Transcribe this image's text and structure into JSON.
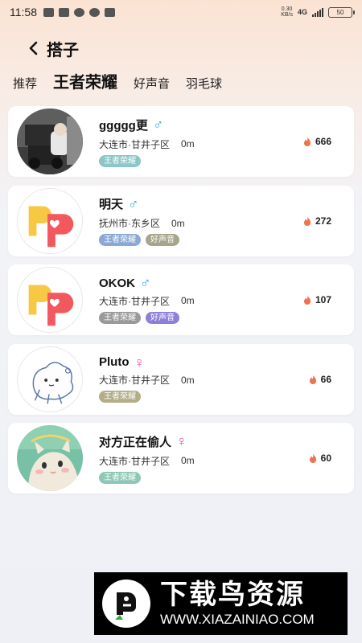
{
  "status_bar": {
    "time": "11:58",
    "netspeed_top": "0.30",
    "netspeed_bottom": "KB/s",
    "network": "4G",
    "battery": "50"
  },
  "header": {
    "title": "搭子"
  },
  "tabs": [
    {
      "label": "推荐",
      "active": false
    },
    {
      "label": "王者荣耀",
      "active": true
    },
    {
      "label": "好声音",
      "active": false
    },
    {
      "label": "羽毛球",
      "active": false
    }
  ],
  "users": [
    {
      "name": "ggggg更",
      "gender": "male",
      "gender_symbol": "♂",
      "city": "大连市·甘井子区",
      "distance": "0m",
      "tags": [
        "王者荣耀"
      ],
      "heat": "666"
    },
    {
      "name": "明天",
      "gender": "male",
      "gender_symbol": "♂",
      "city": "抚州市·东乡区",
      "distance": "0m",
      "tags": [
        "王者荣耀",
        "好声音"
      ],
      "heat": "272"
    },
    {
      "name": "OKOK",
      "gender": "male",
      "gender_symbol": "♂",
      "city": "大连市·甘井子区",
      "distance": "0m",
      "tags": [
        "王者荣耀",
        "好声音"
      ],
      "heat": "107"
    },
    {
      "name": "Pluto",
      "gender": "female",
      "gender_symbol": "♀",
      "city": "大连市·甘井子区",
      "distance": "0m",
      "tags": [
        "王者荣耀"
      ],
      "heat": "66"
    },
    {
      "name": "对方正在偷人",
      "gender": "female",
      "gender_symbol": "♀",
      "city": "大连市·甘井子区",
      "distance": "0m",
      "tags": [
        "王者荣耀"
      ],
      "heat": "60"
    }
  ],
  "tag_colors": [
    "#8cc6c6",
    "#8aa8d6",
    "#9a9a9a",
    "#b3ae88",
    "#8ec7b6"
  ],
  "tag_colors_secondary": {
    "好声音": [
      "#a8a48a",
      "#8f7fd8"
    ]
  },
  "watermark": {
    "title": "下载鸟资源",
    "url": "WWW.XIAZAINIAO.COM"
  }
}
